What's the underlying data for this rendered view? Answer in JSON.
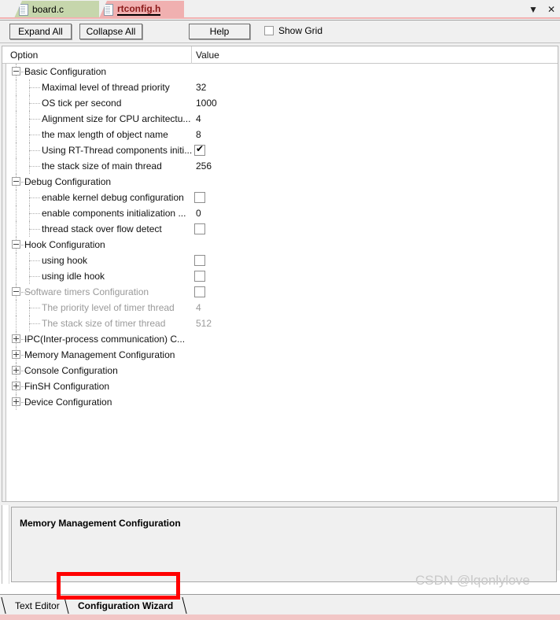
{
  "window": {
    "doc_tabs": [
      {
        "label": "board.c",
        "active": false,
        "icon": "file-icon"
      },
      {
        "label": "rtconfig.h",
        "active": true,
        "icon": "file-icon"
      }
    ],
    "controls": {
      "dropdown": "▼",
      "close": "✕"
    }
  },
  "toolbar": {
    "expand_all": "Expand All",
    "collapse_all": "Collapse All",
    "help": "Help",
    "show_grid_label": "Show Grid",
    "show_grid_checked": false
  },
  "tree": {
    "columns": {
      "option": "Option",
      "value": "Value"
    },
    "rows": [
      {
        "label": "Basic Configuration",
        "value": "",
        "type": "group",
        "expander": "minus",
        "depth": 0,
        "dim": false,
        "selected": false
      },
      {
        "label": "Maximal level of thread priority",
        "value": "32",
        "type": "text",
        "expander": "none",
        "depth": 1,
        "dim": false,
        "selected": false
      },
      {
        "label": "OS tick per second",
        "value": "1000",
        "type": "text",
        "expander": "none",
        "depth": 1,
        "dim": false,
        "selected": false
      },
      {
        "label": "Alignment size for CPU architectu...",
        "value": "4",
        "type": "text",
        "expander": "none",
        "depth": 1,
        "dim": false,
        "selected": false
      },
      {
        "label": "the max length of object name",
        "value": "8",
        "type": "text",
        "expander": "none",
        "depth": 1,
        "dim": false,
        "selected": false
      },
      {
        "label": "Using RT-Thread components initi...",
        "value": "true",
        "type": "checkbox",
        "expander": "none",
        "depth": 1,
        "dim": false,
        "selected": false
      },
      {
        "label": "the stack size of main thread",
        "value": "256",
        "type": "text",
        "expander": "none",
        "depth": 1,
        "dim": false,
        "selected": false
      },
      {
        "label": "Debug Configuration",
        "value": "",
        "type": "group",
        "expander": "minus",
        "depth": 0,
        "dim": false,
        "selected": false
      },
      {
        "label": "enable kernel debug configuration",
        "value": "false",
        "type": "checkbox",
        "expander": "none",
        "depth": 1,
        "dim": false,
        "selected": false
      },
      {
        "label": "enable components initialization ...",
        "value": "0",
        "type": "text",
        "expander": "none",
        "depth": 1,
        "dim": false,
        "selected": false
      },
      {
        "label": "thread stack over flow detect",
        "value": "false",
        "type": "checkbox",
        "expander": "none",
        "depth": 1,
        "dim": false,
        "selected": false
      },
      {
        "label": "Hook Configuration",
        "value": "",
        "type": "group",
        "expander": "minus",
        "depth": 0,
        "dim": false,
        "selected": false
      },
      {
        "label": "using hook",
        "value": "false",
        "type": "checkbox",
        "expander": "none",
        "depth": 1,
        "dim": false,
        "selected": false
      },
      {
        "label": "using idle hook",
        "value": "false",
        "type": "checkbox",
        "expander": "none",
        "depth": 1,
        "dim": false,
        "selected": false
      },
      {
        "label": "Software timers Configuration",
        "value": "false",
        "type": "checkbox",
        "expander": "minus",
        "depth": 0,
        "dim": true,
        "selected": false
      },
      {
        "label": "The priority level of timer thread",
        "value": "4",
        "type": "text",
        "expander": "none",
        "depth": 1,
        "dim": true,
        "selected": false
      },
      {
        "label": "The stack size of timer thread",
        "value": "512",
        "type": "text",
        "expander": "none",
        "depth": 1,
        "dim": true,
        "selected": false
      },
      {
        "label": "IPC(Inter-process communication) C...",
        "value": "",
        "type": "group",
        "expander": "plus",
        "depth": 0,
        "dim": false,
        "selected": false
      },
      {
        "label": "Memory Management Configuration",
        "value": "",
        "type": "group",
        "expander": "plus",
        "depth": 0,
        "dim": false,
        "selected": true
      },
      {
        "label": "Console Configuration",
        "value": "",
        "type": "group",
        "expander": "plus",
        "depth": 0,
        "dim": false,
        "selected": false
      },
      {
        "label": "FinSH Configuration",
        "value": "",
        "type": "group",
        "expander": "plus",
        "depth": 0,
        "dim": false,
        "selected": false
      },
      {
        "label": "Device Configuration",
        "value": "",
        "type": "group",
        "expander": "plus",
        "depth": 0,
        "dim": false,
        "selected": false
      }
    ]
  },
  "description": {
    "title": "Memory Management Configuration"
  },
  "bottom_tabs": [
    {
      "label": "Text Editor",
      "active": false
    },
    {
      "label": "Configuration Wizard",
      "active": true
    }
  ],
  "watermark": "CSDN @lqonlylove",
  "colors": {
    "active_tab_bg": "#f0b0b0",
    "inactive_tab_bg": "#c6d6ac",
    "annotation": "#ff0000",
    "selection": "#e9e9e9",
    "dimmed_text": "#9a9a9a"
  }
}
